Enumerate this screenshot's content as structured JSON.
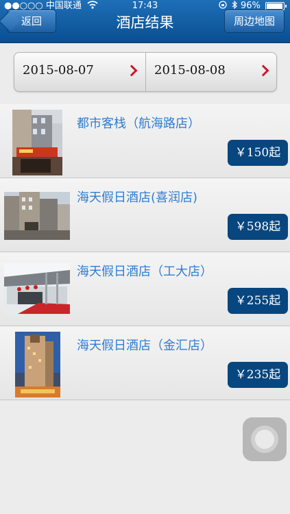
{
  "status_bar": {
    "carrier": "●●○○○ 中国联通",
    "time": "17:43",
    "battery": "96%",
    "battery_level": 0.96
  },
  "nav": {
    "title": "酒店结果",
    "back_label": "返回",
    "map_label": "周边地图"
  },
  "dates": {
    "check_in": "2015-08-07",
    "check_out": "2015-08-08"
  },
  "hotels": [
    {
      "name": "都市客栈（航海路店）",
      "price": "￥150起"
    },
    {
      "name": "海天假日酒店(喜润店)",
      "price": "￥598起"
    },
    {
      "name": "海天假日酒店（工大店）",
      "price": "￥255起"
    },
    {
      "name": "海天假日酒店（金汇店）",
      "price": "￥235起"
    }
  ],
  "colors": {
    "nav_blue": "#0a4e92",
    "price_badge": "#08467f",
    "hotel_name": "#2f7dd1",
    "chevron_red": "#d0152b"
  },
  "icons": [
    "wifi-icon",
    "lock-rotation-icon",
    "bluetooth-icon",
    "battery-icon",
    "chevron-right-icon",
    "assistive-touch-icon"
  ]
}
